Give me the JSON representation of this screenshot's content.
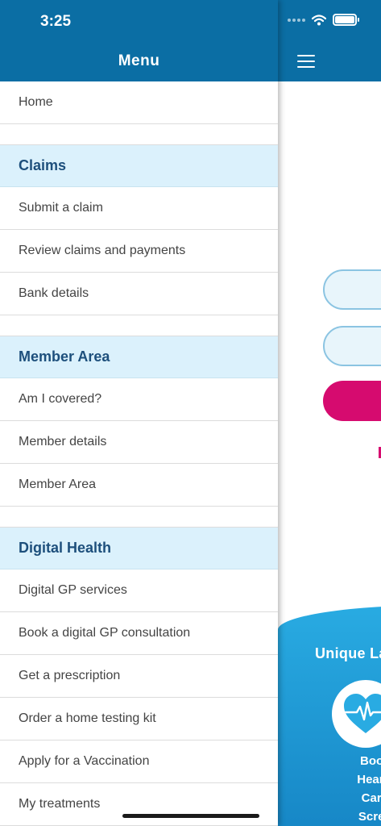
{
  "status_bar": {
    "time": "3:25"
  },
  "drawer": {
    "title": "Menu",
    "home_label": "Home",
    "sections": [
      {
        "title": "Claims",
        "items": [
          "Submit a claim",
          "Review claims and payments",
          "Bank details"
        ]
      },
      {
        "title": "Member Area",
        "items": [
          "Am I covered?",
          "Member details",
          "Member Area"
        ]
      },
      {
        "title": "Digital Health",
        "items": [
          "Digital GP services",
          "Book a digital GP consultation",
          "Get a prescription",
          "Order a home testing kit",
          "Apply for a Vaccination",
          "My treatments"
        ]
      }
    ]
  },
  "background_screen": {
    "promo_title": "Unique La",
    "promo_lines": [
      "Book a",
      "HeartBe",
      "Cardia",
      "Screeni"
    ]
  },
  "colors": {
    "header_blue": "#0b6ea4",
    "section_bg": "#dbf1fc",
    "section_text": "#1d4f7c",
    "accent_pink": "#d60b6f",
    "promo_blue": "#29abe2"
  },
  "icons": {
    "menu": "hamburger-icon",
    "wifi": "wifi-icon",
    "battery": "battery-icon",
    "promo": "heartbeat-icon"
  }
}
